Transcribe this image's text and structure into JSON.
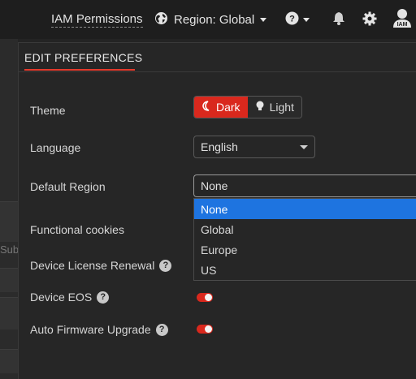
{
  "topbar": {
    "iam_label": "IAM Permissions",
    "region_label": "Region: Global",
    "avatar_text": "IAM",
    "icons": [
      "globe-icon",
      "help-icon",
      "bell-icon",
      "gear-icon",
      "user-avatar-icon"
    ]
  },
  "background": {
    "sub_text": "Sub"
  },
  "panel": {
    "title": "EDIT PREFERENCES",
    "theme": {
      "label": "Theme",
      "options": [
        "Dark",
        "Light"
      ],
      "selected": "Dark"
    },
    "language": {
      "label": "Language",
      "value": "English"
    },
    "default_region": {
      "label": "Default Region",
      "value": "None",
      "options": [
        "None",
        "Global",
        "Europe",
        "US"
      ],
      "highlighted": "None"
    },
    "functional_cookies": {
      "label": "Functional cookies"
    },
    "device_license_renewal": {
      "label": "Device License Renewal"
    },
    "device_eos": {
      "label": "Device EOS",
      "enabled": true
    },
    "auto_firmware_upgrade": {
      "label": "Auto Firmware Upgrade",
      "enabled": true
    }
  },
  "colors": {
    "accent": "#d9281d",
    "highlight": "#1e74e0",
    "background": "#242424"
  }
}
